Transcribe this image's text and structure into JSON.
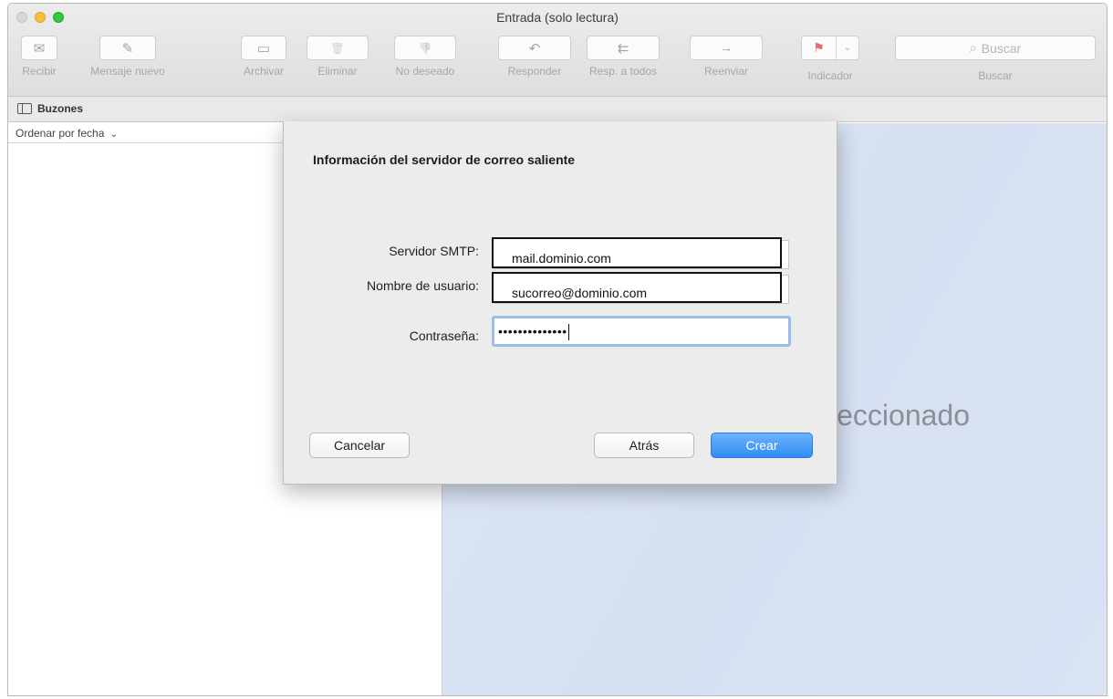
{
  "window": {
    "title": "Entrada (solo lectura)"
  },
  "toolbar": {
    "items": [
      {
        "label": "Recibir",
        "icon": "envelope-icon",
        "glyph": "✉"
      },
      {
        "label": "Mensaje nuevo",
        "icon": "compose-icon",
        "glyph": "✎"
      },
      {
        "label": "Archivar",
        "icon": "archive-icon",
        "glyph": "▭"
      },
      {
        "label": "Eliminar",
        "icon": "trash-icon",
        "glyph": "🗑"
      },
      {
        "label": "No deseado",
        "icon": "junk-icon",
        "glyph": "👎"
      },
      {
        "label": "Responder",
        "icon": "reply-icon",
        "glyph": "↶"
      },
      {
        "label": "Resp. a todos",
        "icon": "reply-all-icon",
        "glyph": "⇇"
      },
      {
        "label": "Reenviar",
        "icon": "forward-icon",
        "glyph": "→"
      }
    ],
    "flag_label": "Indicador",
    "search_placeholder": "Buscar",
    "search_label": "Buscar"
  },
  "favorites": {
    "mailboxes_label": "Buzones"
  },
  "message_list": {
    "sort_label": "Ordenar por fecha"
  },
  "viewer": {
    "no_selection_text": "leccionado"
  },
  "dialog": {
    "title": "Información del servidor de correo saliente",
    "fields": {
      "smtp_label": "Servidor SMTP:",
      "smtp_value": "mail.dominio.com",
      "username_label": "Nombre de usuario:",
      "username_value": "sucorreo@dominio.com",
      "password_label": "Contraseña:",
      "password_value": "••••••••••••••"
    },
    "buttons": {
      "cancel": "Cancelar",
      "back": "Atrás",
      "create": "Crear"
    }
  },
  "colors": {
    "primary_button": "#2f8cf5",
    "viewer_bg": "#d6e0f1",
    "flag": "#ec6a6a"
  }
}
